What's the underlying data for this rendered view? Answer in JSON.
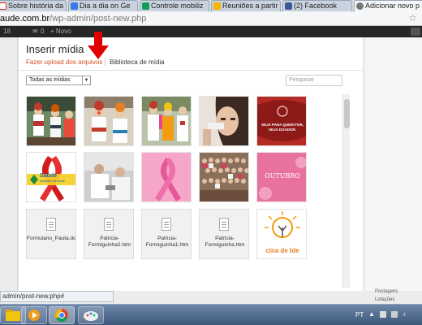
{
  "browser": {
    "tabs": [
      {
        "label": "Sobre história da",
        "icon": "gmail-icon",
        "color": "#d93025"
      },
      {
        "label": "Dia a dia on Ge",
        "icon": "docs-icon",
        "color": "#3b78e7"
      },
      {
        "label": "Controle mobiliz",
        "icon": "sheets-icon",
        "color": "#0f9d58"
      },
      {
        "label": "Reuniões a partir",
        "icon": "drive-icon",
        "color": "#f4b400"
      },
      {
        "label": "(2) Facebook",
        "icon": "facebook-icon",
        "color": "#3b5998"
      },
      {
        "label": "Adicionar novo p",
        "icon": "wordpress-icon",
        "color": "#555555"
      }
    ],
    "address_prefix": "aude.com.br",
    "address_path": "/wp-admin/post-new.php",
    "status_url": "admin/post-new.php#"
  },
  "wp_admin_bar": {
    "items": [
      "18",
      "0",
      "+ Novo"
    ]
  },
  "modal": {
    "title": "Inserir mídia",
    "tab_upload": "Fazer upload dos arquivos",
    "tab_library": "Biblioteca de mídia",
    "filter_value": "Todas as mídias",
    "search_placeholder": "Pesquisar",
    "accent_color": "#d54e21",
    "arrow_color": "#e00000"
  },
  "media": {
    "row1": [
      {
        "kind": "photo",
        "desc": "clowns-hospital"
      },
      {
        "kind": "photo",
        "desc": "clown-nurses"
      },
      {
        "kind": "photo",
        "desc": "clown-doctors"
      },
      {
        "kind": "photo",
        "desc": "woman-portrait"
      },
      {
        "kind": "poster",
        "caption": "SEJA PARA QUEM FOR, SEJA DOADOR."
      }
    ],
    "row2": [
      {
        "kind": "logo",
        "caption": "Saúde",
        "sub": "Ministério da Saúde"
      },
      {
        "kind": "photo",
        "desc": "doctor-meeting"
      },
      {
        "kind": "ribbon",
        "desc": "pink-ribbon"
      },
      {
        "kind": "photo",
        "desc": "group-photo"
      },
      {
        "kind": "banner",
        "caption": "OUTUBRO"
      }
    ],
    "row3": [
      {
        "kind": "file",
        "name": "Formulario_Pauta.doc"
      },
      {
        "kind": "file",
        "name": "Patricia-Formiguinha2.htm"
      },
      {
        "kind": "file",
        "name": "Patricia-Formiguinha1.htm"
      },
      {
        "kind": "file",
        "name": "Patricia-Formiguinha.htm"
      },
      {
        "kind": "sketch",
        "caption": "cina de Ide"
      }
    ]
  },
  "right_panel": {
    "item1": "Postagens",
    "item2": "Lotações"
  },
  "taskbar": {
    "clock": "PT"
  }
}
